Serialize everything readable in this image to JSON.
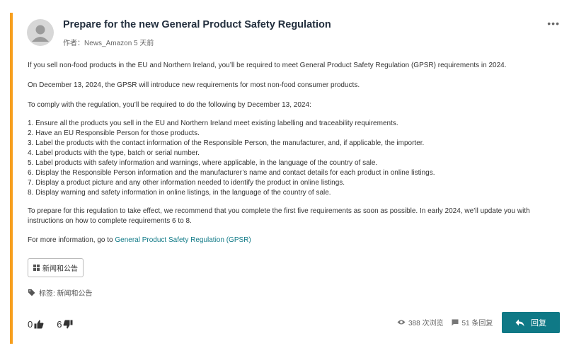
{
  "post": {
    "title": "Prepare for the new General Product Safety Regulation",
    "meta": "作者：News_Amazon 5 天前",
    "more_label": "•••"
  },
  "body": {
    "p1": "If you sell non-food products in the EU and Northern Ireland, you’ll be required to meet General Product Safety Regulation (GPSR) requirements in 2024.",
    "p2": "On December 13, 2024, the GPSR will introduce new requirements for most non-food consumer products.",
    "p3": "To comply with the regulation, you’ll be required to do the following by December 13, 2024:",
    "steps": [
      "1. Ensure all the products you sell in the EU and Northern Ireland meet existing labelling and traceability requirements.",
      "2. Have an EU Responsible Person for those products.",
      "3. Label the products with the contact information of the Responsible Person, the manufacturer, and, if applicable, the importer.",
      "4. Label products with the type, batch or serial number.",
      "5. Label products with safety information and warnings, where applicable, in the language of the country of sale.",
      "6. Display the Responsible Person information and the manufacturer’s name and contact details for each product in online listings.",
      "7. Display a product picture and any other information needed to identify the product in online listings.",
      "8. Display warning and safety information in online listings, in the language of the country of sale."
    ],
    "p4": "To prepare for this regulation to take effect, we recommend that you complete the first five requirements as soon as possible. In early 2024, we’ll update you with instructions on how to complete requirements 6 to 8.",
    "p5_prefix": "For more information, go to ",
    "p5_link": "General Product Safety Regulation (GPSR)"
  },
  "board_button": "新闻和公告",
  "labels": "标签: 新闻和公告",
  "votes": {
    "up": "0",
    "down": "6"
  },
  "stats": {
    "views": "388 次浏览",
    "replies": "51 条回复"
  },
  "reply_label": "回复",
  "colors": {
    "accent": "#f79f1e",
    "link": "#0f7986",
    "reply_bg": "#0f7986"
  }
}
